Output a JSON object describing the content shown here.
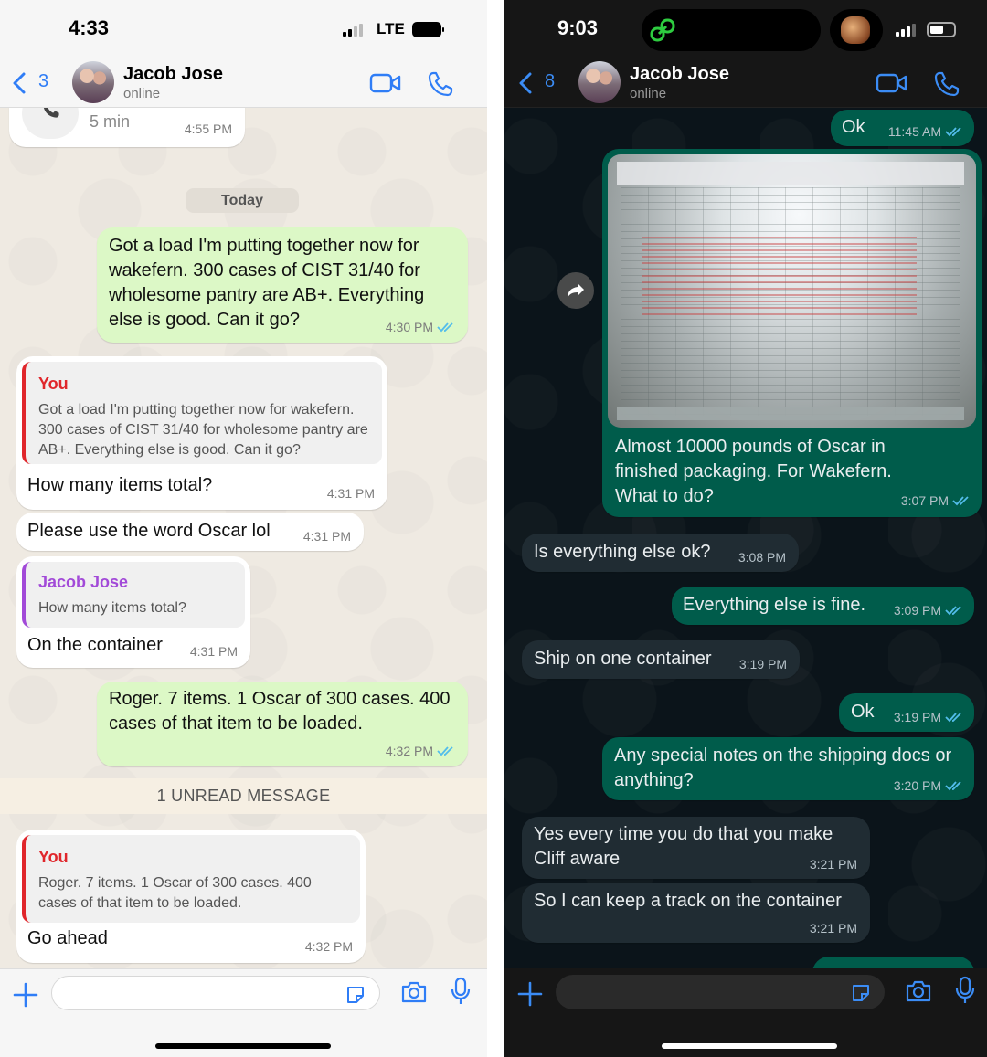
{
  "left": {
    "status": {
      "time": "4:33",
      "network": "LTE"
    },
    "header": {
      "back_count": "3",
      "name": "Jacob Jose",
      "status": "online"
    },
    "top_call": {
      "duration": "5 min",
      "time": "4:55 PM"
    },
    "date_divider": "Today",
    "messages": [
      {
        "dir": "out",
        "text": "Got a load I'm putting together now for wakefern.  300 cases of CIST 31/40 for wholesome pantry are AB+.  Everything else is good.  Can it go?",
        "time": "4:30 PM"
      },
      {
        "dir": "in",
        "quote_name": "You",
        "quote_text": "Got a load I'm putting together now for wakefern.  300 cases of CIST 31/40 for wholesome pantry are AB+.  Everything else is good.  Can it go?",
        "text": "How many items total?",
        "time": "4:31 PM"
      },
      {
        "dir": "in",
        "text": "Please use the word Oscar lol",
        "time": "4:31 PM"
      },
      {
        "dir": "in",
        "quote_name": "Jacob Jose",
        "quote_text": "How many items total?",
        "text": "On the container",
        "time": "4:31 PM"
      },
      {
        "dir": "out",
        "text": "Roger.  7 items.  1 Oscar of 300 cases.  400 cases of that item to be loaded.",
        "time": "4:32 PM"
      },
      {
        "dir": "in",
        "quote_name": "You",
        "quote_text": "Roger.  7 items.  1 Oscar of 300 cases.  400 cases of that item to be loaded.",
        "text": "Go ahead",
        "time": "4:32 PM"
      }
    ],
    "unread_label": "1 UNREAD MESSAGE"
  },
  "right": {
    "status": {
      "time": "9:03"
    },
    "header": {
      "back_count": "8",
      "name": "Jacob Jose",
      "status": "online"
    },
    "messages": [
      {
        "dir": "out",
        "text": "Ok",
        "time": "11:45 AM"
      },
      {
        "dir": "out",
        "image": true,
        "text": "Almost 10000 pounds of Oscar in finished packaging.  For Wakefern.  What to do?",
        "time": "3:07 PM"
      },
      {
        "dir": "in",
        "text": "Is everything else ok?",
        "time": "3:08 PM"
      },
      {
        "dir": "out",
        "text": "Everything else is fine.",
        "time": "3:09 PM"
      },
      {
        "dir": "in",
        "text": "Ship on one container",
        "time": "3:19 PM"
      },
      {
        "dir": "out",
        "text": "Ok",
        "time": "3:19 PM"
      },
      {
        "dir": "out",
        "text": "Any special notes on the shipping docs or anything?",
        "time": "3:20 PM"
      },
      {
        "dir": "in",
        "text": "Yes every time you do that you make Cliff aware",
        "time": "3:21 PM"
      },
      {
        "dir": "in",
        "text": "So I can keep a track on the container",
        "time": "3:21 PM"
      }
    ]
  },
  "colors": {
    "left_bg": "#efeae2",
    "left_out": "#dcf8c6",
    "left_in": "#ffffff",
    "right_bg": "#0b141a",
    "right_out": "#005c4b",
    "right_in": "#202c33",
    "ios_blue": "#2f7df6",
    "read_ticks": "#53bdeb",
    "quote_you": "#e0262b",
    "quote_jacob": "#a24ad8"
  },
  "icons": [
    "back-chevron-icon",
    "video-call-icon",
    "voice-call-icon",
    "phone-call-icon",
    "read-ticks-icon",
    "forward-icon",
    "plus-icon",
    "sticker-icon",
    "camera-icon",
    "microphone-icon",
    "link-icon",
    "signal-icon",
    "battery-icon"
  ]
}
